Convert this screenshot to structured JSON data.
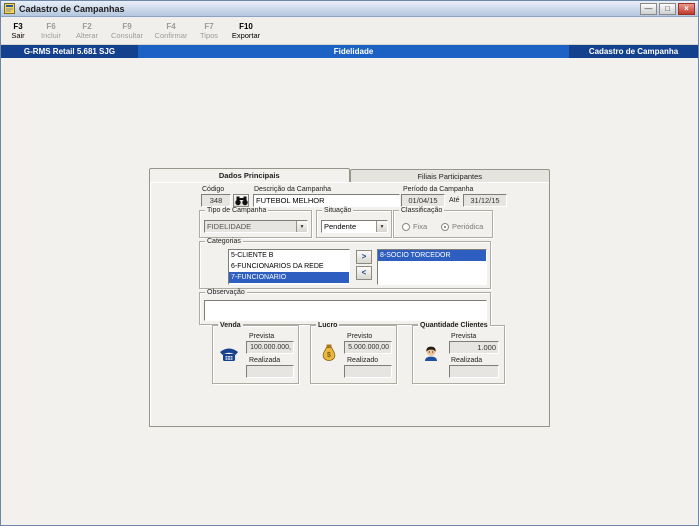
{
  "window": {
    "title": "Cadastro de Campanhas"
  },
  "icons": {
    "minimize": "—",
    "maximize": "□",
    "close": "×",
    "dropdown": "▼"
  },
  "toolbar": {
    "buttons": [
      {
        "key": "F3",
        "label": "Sair",
        "enabled": true
      },
      {
        "key": "F6",
        "label": "Incluir",
        "enabled": false
      },
      {
        "key": "F2",
        "label": "Alterar",
        "enabled": false
      },
      {
        "key": "F9",
        "label": "Consultar",
        "enabled": false
      },
      {
        "key": "F4",
        "label": "Confirmar",
        "enabled": false
      },
      {
        "key": "F7",
        "label": "Tipos",
        "enabled": false
      },
      {
        "key": "F10",
        "label": "Exportar",
        "enabled": true
      }
    ]
  },
  "header": {
    "left": "G-RMS Retail 5.681 SJG",
    "center": "Fidelidade",
    "right": "Cadastro de Campanha",
    "left_bg": "#14418e",
    "center_bg": "#1b62c4",
    "right_bg": "#14418e"
  },
  "tabs": {
    "main": "Dados Principais",
    "secondary": "Filiais Participantes"
  },
  "form": {
    "codigo_label": "Código",
    "codigo_value": "348",
    "descricao_label": "Descrição da Campanha",
    "descricao_value": "FUTEBOL MELHOR",
    "periodo_label": "Período da Campanha",
    "periodo_inicio": "01/04/15",
    "ate_label": "Até",
    "periodo_fim": "31/12/15",
    "tipo_label": "Tipo de Campanha",
    "tipo_value": "FIDELIDADE",
    "situacao_label": "Situação",
    "situacao_value": "Pendente",
    "classificacao_label": "Classificação",
    "classificacao_fixa": "Fixa",
    "classificacao_periodica": "Periódica",
    "classificacao_selecionada": "Periódica",
    "categorias_label": "Categorias",
    "categorias_disponiveis": [
      "5-CLIENTE B",
      "6-FUNCIONARIOS DA REDE",
      "7-FUNCIONARIO"
    ],
    "categoria_disponivel_selecionada": "7-FUNCIONARIO",
    "categorias_escolhidas": [
      "8-SOCIO TORCEDOR"
    ],
    "mover_direita": ">",
    "mover_esquerda": "<",
    "observacao_label": "Observação",
    "observacao_value": ""
  },
  "totais": {
    "venda": {
      "title": "Venda",
      "prevista_label": "Prevista",
      "prevista_value": "100.000.000,",
      "realizada_label": "Realizada",
      "realizada_value": ""
    },
    "lucro": {
      "title": "Lucro",
      "previsto_label": "Previsto",
      "previsto_value": "5.000.000,00",
      "realizado_label": "Realizado",
      "realizado_value": ""
    },
    "clientes": {
      "title": "Quantidade Clientes",
      "prevista_label": "Prevista",
      "prevista_value": "1.000",
      "realizada_label": "Realizada",
      "realizada_value": ""
    }
  }
}
